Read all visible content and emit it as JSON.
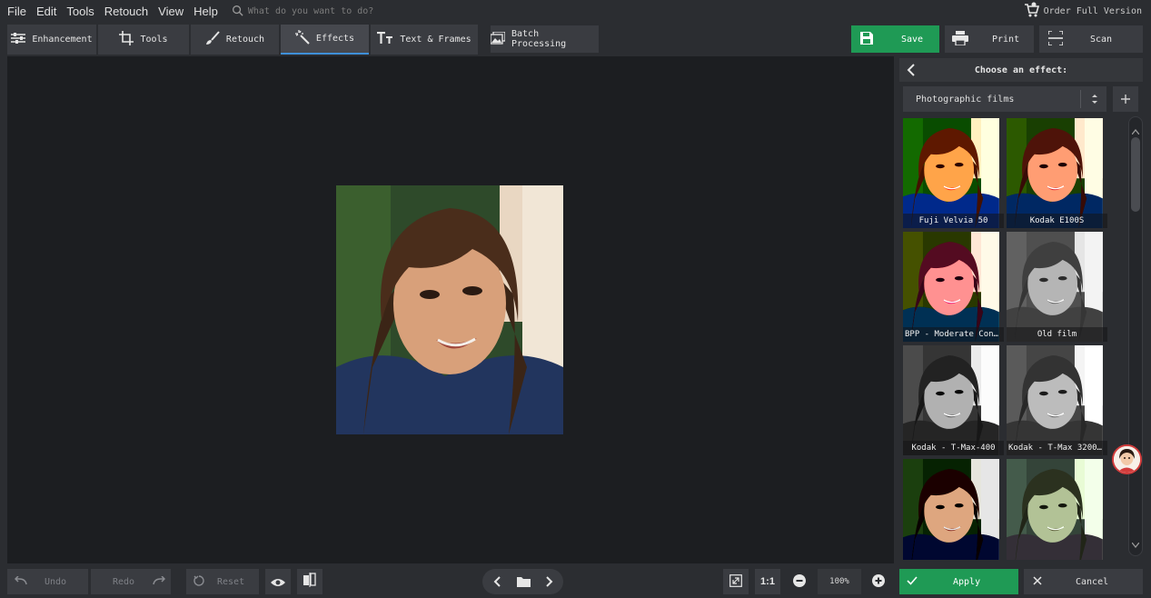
{
  "menu": [
    "File",
    "Edit",
    "Tools",
    "Retouch",
    "View",
    "Help"
  ],
  "search": {
    "placeholder": "What do you want to do?"
  },
  "order_label": "Order Full Version",
  "tabs": [
    {
      "label": "Enhancement",
      "icon": "sliders-icon"
    },
    {
      "label": "Tools",
      "icon": "crop-icon"
    },
    {
      "label": "Retouch",
      "icon": "brush-icon"
    },
    {
      "label": "Effects",
      "icon": "magic-wand-icon",
      "active": true
    },
    {
      "label": "Text & Frames",
      "icon": "text-icon"
    }
  ],
  "batch_label": "Batch Processing",
  "actions": {
    "save": "Save",
    "print": "Print",
    "scan": "Scan"
  },
  "panel": {
    "title": "Choose an effect:",
    "category": "Photographic films",
    "effects": [
      {
        "label": "Fuji Velvia 50",
        "style": "velvia"
      },
      {
        "label": "Kodak E100S",
        "style": "e100s"
      },
      {
        "label": "BPP - Moderate Conta…",
        "style": "bpp"
      },
      {
        "label": "Old film",
        "style": "oldfilm"
      },
      {
        "label": "Kodak - T-Max-400",
        "style": "tmax400"
      },
      {
        "label": "Kodak - T-Max 3200 P…",
        "style": "tmax3200"
      },
      {
        "label": "",
        "style": "contrast"
      },
      {
        "label": "",
        "style": "green"
      }
    ]
  },
  "bottom": {
    "undo": "Undo",
    "redo": "Redo",
    "reset": "Reset",
    "one_to_one": "1:1",
    "zoom": "100%",
    "apply": "Apply",
    "cancel": "Cancel"
  },
  "colors": {
    "accent_green": "#1f9a55",
    "active_tab_underline": "#3f8fd8",
    "canvas_bg": "#1c1e21"
  }
}
